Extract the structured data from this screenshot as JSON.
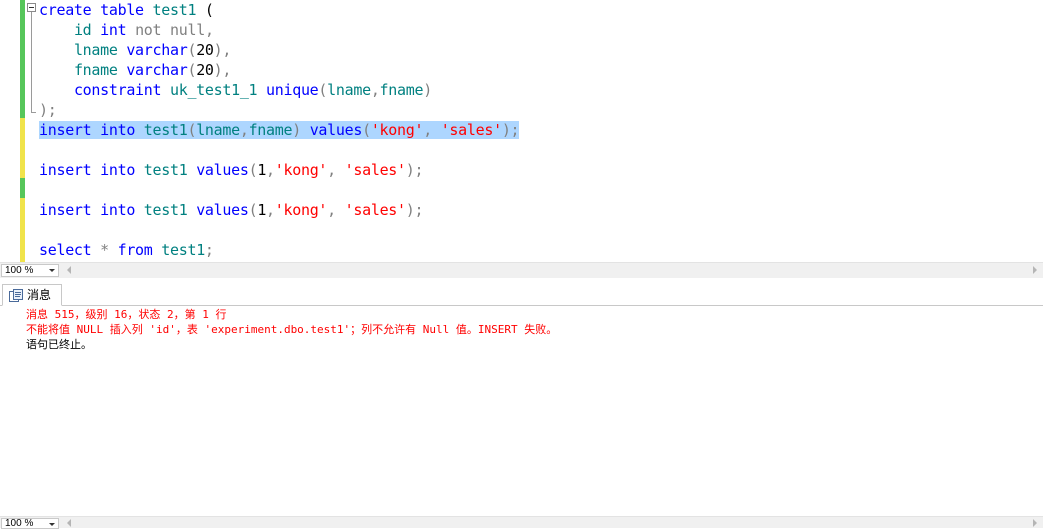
{
  "editor": {
    "zoom": "100 %",
    "lines": [
      [
        {
          "t": "create",
          "c": "kw"
        },
        {
          "t": " "
        },
        {
          "t": "table",
          "c": "kw"
        },
        {
          "t": " "
        },
        {
          "t": "test1",
          "c": "id"
        },
        {
          "t": " ("
        }
      ],
      [
        {
          "t": "    "
        },
        {
          "t": "id",
          "c": "id"
        },
        {
          "t": " "
        },
        {
          "t": "int",
          "c": "kw"
        },
        {
          "t": " "
        },
        {
          "t": "not",
          "c": "gr"
        },
        {
          "t": " "
        },
        {
          "t": "null",
          "c": "gr"
        },
        {
          "t": ",",
          "c": "gr"
        }
      ],
      [
        {
          "t": "    "
        },
        {
          "t": "lname",
          "c": "id"
        },
        {
          "t": " "
        },
        {
          "t": "varchar",
          "c": "kw"
        },
        {
          "t": "(",
          "c": "gr"
        },
        {
          "t": "20"
        },
        {
          "t": "),",
          "c": "gr"
        }
      ],
      [
        {
          "t": "    "
        },
        {
          "t": "fname",
          "c": "id"
        },
        {
          "t": " "
        },
        {
          "t": "varchar",
          "c": "kw"
        },
        {
          "t": "(",
          "c": "gr"
        },
        {
          "t": "20"
        },
        {
          "t": "),",
          "c": "gr"
        }
      ],
      [
        {
          "t": "    "
        },
        {
          "t": "constraint",
          "c": "kw"
        },
        {
          "t": " "
        },
        {
          "t": "uk_test1_1",
          "c": "id"
        },
        {
          "t": " "
        },
        {
          "t": "unique",
          "c": "kw"
        },
        {
          "t": "(",
          "c": "gr"
        },
        {
          "t": "lname",
          "c": "id"
        },
        {
          "t": ",",
          "c": "gr"
        },
        {
          "t": "fname",
          "c": "id"
        },
        {
          "t": ")",
          "c": "gr"
        }
      ],
      [
        {
          "t": ");",
          "c": "gr"
        }
      ],
      [
        {
          "t": "insert",
          "c": "kw"
        },
        {
          "t": " "
        },
        {
          "t": "into",
          "c": "kw"
        },
        {
          "t": " "
        },
        {
          "t": "test1",
          "c": "id"
        },
        {
          "t": "(",
          "c": "gr"
        },
        {
          "t": "lname",
          "c": "id"
        },
        {
          "t": ",",
          "c": "gr"
        },
        {
          "t": "fname",
          "c": "id"
        },
        {
          "t": ")",
          "c": "gr"
        },
        {
          "t": " "
        },
        {
          "t": "values",
          "c": "kw"
        },
        {
          "t": "(",
          "c": "gr"
        },
        {
          "t": "'kong'",
          "c": "str"
        },
        {
          "t": ",",
          "c": "gr"
        },
        {
          "t": " "
        },
        {
          "t": "'sales'",
          "c": "str"
        },
        {
          "t": ");",
          "c": "gr"
        }
      ],
      [],
      [
        {
          "t": "insert",
          "c": "kw"
        },
        {
          "t": " "
        },
        {
          "t": "into",
          "c": "kw"
        },
        {
          "t": " "
        },
        {
          "t": "test1",
          "c": "id"
        },
        {
          "t": " "
        },
        {
          "t": "values",
          "c": "kw"
        },
        {
          "t": "(",
          "c": "gr"
        },
        {
          "t": "1"
        },
        {
          "t": ",",
          "c": "gr"
        },
        {
          "t": "'kong'",
          "c": "str"
        },
        {
          "t": ",",
          "c": "gr"
        },
        {
          "t": " "
        },
        {
          "t": "'sales'",
          "c": "str"
        },
        {
          "t": ");",
          "c": "gr"
        }
      ],
      [],
      [
        {
          "t": "insert",
          "c": "kw"
        },
        {
          "t": " "
        },
        {
          "t": "into",
          "c": "kw"
        },
        {
          "t": " "
        },
        {
          "t": "test1",
          "c": "id"
        },
        {
          "t": " "
        },
        {
          "t": "values",
          "c": "kw"
        },
        {
          "t": "(",
          "c": "gr"
        },
        {
          "t": "1"
        },
        {
          "t": ",",
          "c": "gr"
        },
        {
          "t": "'kong'",
          "c": "str"
        },
        {
          "t": ",",
          "c": "gr"
        },
        {
          "t": " "
        },
        {
          "t": "'sales'",
          "c": "str"
        },
        {
          "t": ");",
          "c": "gr"
        }
      ],
      [],
      [
        {
          "t": "select",
          "c": "kw"
        },
        {
          "t": " "
        },
        {
          "t": "*",
          "c": "gr"
        },
        {
          "t": " "
        },
        {
          "t": "from",
          "c": "kw"
        },
        {
          "t": " "
        },
        {
          "t": "test1",
          "c": "id"
        },
        {
          "t": ";",
          "c": "gr"
        }
      ]
    ],
    "selected_line": 6
  },
  "results": {
    "tab_label": "消息",
    "zoom": "100 %",
    "messages": [
      {
        "text": "消息 515，级别 16，状态 2，第 1 行",
        "kind": "err"
      },
      {
        "text": "不能将值 NULL 插入列 'id'，表 'experiment.dbo.test1'；列不允许有 Null 值。INSERT 失败。",
        "kind": "err"
      },
      {
        "text": "语句已终止。",
        "kind": "ok"
      }
    ]
  },
  "colors": {
    "keyword": "#0000ff",
    "identifier": "#008080",
    "string": "#ff0000",
    "gray": "#808080",
    "selection": "#add6ff",
    "change_saved": "#56c65a",
    "change_unsaved": "#f0e34a",
    "error_text": "#ff0000"
  }
}
